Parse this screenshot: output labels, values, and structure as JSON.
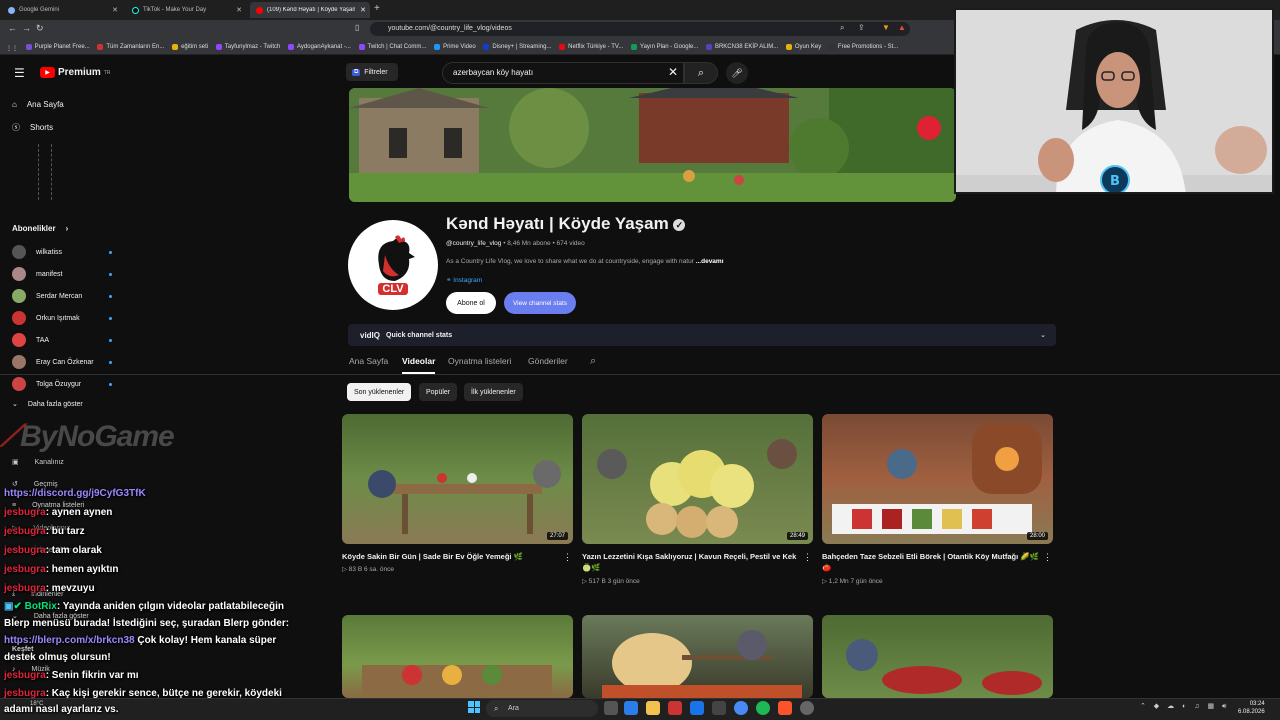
{
  "browser": {
    "tabs": [
      {
        "label": "Google Gemini",
        "active": false
      },
      {
        "label": "TikTok - Make Your Day",
        "active": false
      },
      {
        "label": "(109) Kənd Həyatı | Köyde Yaşam",
        "active": true
      }
    ],
    "new_tab_symbol": "+",
    "url": "youtube.com/@country_life_vlog/videos",
    "bookmarks": [
      "Purple Planet Free...",
      "Tüm Zamanların En...",
      "eğitim seti",
      "Tayfunylmaz - Twitch",
      "AydoganAykanat -...",
      "Twitch | Chat Comm...",
      "Prime Video",
      "Disney+ | Streaming...",
      "Netflix Türkiye - TV...",
      "Yayın Plan - Google...",
      "BRKCN38 EKİP ALIM...",
      "Oyun Key",
      "Free Promotions - St..."
    ]
  },
  "youtube": {
    "logo": "Premium",
    "logo_sup": "TR",
    "sidebar": {
      "home": "Ana Sayfa",
      "shorts": "Shorts",
      "subscriptions_heading": "Abonelikler",
      "subscriptions": [
        "wilkatiss",
        "manifest",
        "Serdar Mercan",
        "Orkun Işıtmak",
        "TAA",
        "Eray Can Özkenar",
        "Tolga Özuygur"
      ],
      "show_more": "Daha fazla göster",
      "you_items": [
        "Kanalınız",
        "Geçmiş",
        "Oynatma listeleri",
        "Videolarınız",
        "İzlenecekler",
        "İndirilenler",
        "Daha fazla göster"
      ],
      "explore_heading": "Keşfet",
      "music": "Müzik"
    },
    "filters_label": "Filtreler",
    "search_query": "azerbaycan köy hayatı",
    "channel": {
      "name": "Kənd Həyatı | Köyde Yaşam",
      "handle": "@country_life_vlog",
      "meta": "• 8,46 Mn abone • 674 video",
      "description": "As a Country Life Vlog, we love to share what we do at countryside, engage with natur",
      "more": "...devamı",
      "link": "Instagram",
      "subscribe": "Abone ol",
      "stats_btn": "View channel stats",
      "avatar_text": "CLV"
    },
    "vidiq": {
      "brand": "vidIQ",
      "label": "Quick channel stats"
    },
    "tabs": [
      "Ana Sayfa",
      "Videolar",
      "Oynatma listeleri",
      "Gönderiler"
    ],
    "active_tab": "Videolar",
    "chips": [
      "Son yüklenenler",
      "Popüler",
      "İlk yüklenenler"
    ],
    "videos": [
      {
        "title": "Köyde Sakin Bir Gün | Sade Bir Ev Öğle Yemeği 🌿",
        "views": "▷ 83 B",
        "age": "6 sa. önce",
        "duration": "27:07"
      },
      {
        "title": "Yazın Lezzetini Kışa Saklıyoruz | Kavun Reçeli, Pestil ve Kek 🍈🌿",
        "views": "▷ 517 B",
        "age": "3 gün önce",
        "duration": "28:49"
      },
      {
        "title": "Bahçeden Taze Sebzeli Etli Börek | Otantik Köy Mutfağı 🌽🌿🍅",
        "views": "▷ 1,2 Mn",
        "age": "7 gün önce",
        "duration": "28:00"
      }
    ]
  },
  "overlay": {
    "watermark": "ByNoGame",
    "chat": [
      {
        "user": "",
        "text": "",
        "link": "https://discord.gg/j9CyfG3TfK"
      },
      {
        "user": "jesbugra",
        "text": ": aynen aynen"
      },
      {
        "user": "jesbugra",
        "text": ": bu tarz"
      },
      {
        "user": "jesbugra",
        "text": ": tam olarak"
      },
      {
        "user": "jesbugra",
        "text": ": hemen ayıktın"
      },
      {
        "user": "jesbugra",
        "text": ": mevzuyu"
      },
      {
        "user": "BotRix",
        "text": ": Yayında aniden çılgın videolar patlatabileceğin"
      },
      {
        "user": "",
        "text": "Blerp menüsü burada! İstediğini seç, şuradan Blerp gönder:"
      },
      {
        "user": "",
        "link": "https://blerp.com/x/brkcn38",
        "text": " Çok kolay! Hem kanala süper"
      },
      {
        "user": "",
        "text": "destek olmuş olursun!"
      },
      {
        "user": "jesbugra",
        "text": ": Senin fikrin var mı"
      },
      {
        "user": "jesbugra",
        "text": ": Kaç kişi gerekir sence, bütçe ne gerekir, köydeki"
      },
      {
        "user": "",
        "text": "adamı nasıl ayarlarız vs."
      }
    ]
  },
  "taskbar": {
    "search": "Ara",
    "time": "03:24",
    "date": "6.08.2026",
    "weather": "18°C"
  },
  "colors": {
    "accent": "#3ea6ff",
    "yt_red": "#ff0000",
    "subscribe_bg": "#ffffff",
    "stats_bg": "#6a7ef0",
    "chat_user": "#e0243b",
    "chat_link": "#9c88ff"
  }
}
